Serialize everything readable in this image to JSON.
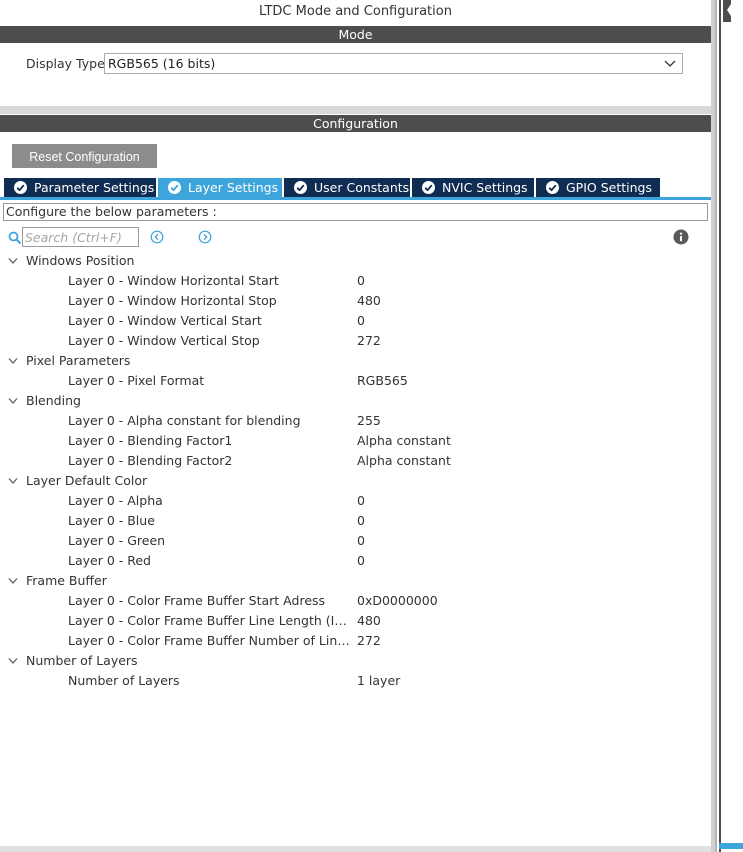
{
  "title": "LTDC Mode and Configuration",
  "mode": {
    "header": "Mode",
    "display_type_label": "Display Type",
    "display_type_value": "RGB565 (16 bits)"
  },
  "configuration": {
    "header": "Configuration",
    "reset_label": "Reset Configuration",
    "tabs": [
      {
        "label": "Parameter Settings",
        "active": false
      },
      {
        "label": "Layer Settings",
        "active": true
      },
      {
        "label": "User Constants",
        "active": false
      },
      {
        "label": "NVIC Settings",
        "active": false
      },
      {
        "label": "GPIO Settings",
        "active": false
      }
    ],
    "instructions": "Configure the below parameters :",
    "search_placeholder": "Search (Ctrl+F)"
  },
  "groups": [
    {
      "name": "Windows Position",
      "params": [
        {
          "name": "Layer 0 - Window Horizontal Start",
          "value": "0"
        },
        {
          "name": "Layer 0 - Window Horizontal Stop",
          "value": "480"
        },
        {
          "name": "Layer 0 - Window Vertical Start",
          "value": "0"
        },
        {
          "name": "Layer 0 - Window Vertical Stop",
          "value": "272"
        }
      ]
    },
    {
      "name": "Pixel Parameters",
      "params": [
        {
          "name": "Layer 0 - Pixel Format",
          "value": "RGB565"
        }
      ]
    },
    {
      "name": "Blending",
      "params": [
        {
          "name": "Layer 0 - Alpha constant for blending",
          "value": "255"
        },
        {
          "name": "Layer 0 - Blending Factor1",
          "value": "Alpha constant"
        },
        {
          "name": "Layer 0 - Blending Factor2",
          "value": "Alpha constant"
        }
      ]
    },
    {
      "name": "Layer Default Color",
      "params": [
        {
          "name": "Layer 0 - Alpha",
          "value": "0"
        },
        {
          "name": "Layer 0 - Blue",
          "value": "0"
        },
        {
          "name": "Layer 0 - Green",
          "value": "0"
        },
        {
          "name": "Layer 0 - Red",
          "value": "0"
        }
      ]
    },
    {
      "name": "Frame Buffer",
      "params": [
        {
          "name": "Layer 0 - Color Frame Buffer Start Adress",
          "value": "0xD0000000"
        },
        {
          "name": "Layer 0 - Color Frame Buffer Line Length (Imag...",
          "value": "480"
        },
        {
          "name": "Layer 0 - Color Frame Buffer Number of Lines (I...",
          "value": "272"
        }
      ]
    },
    {
      "name": "Number of Layers",
      "params": [
        {
          "name": "Number of Layers",
          "value": "1 layer"
        }
      ]
    }
  ],
  "colors": {
    "section_header": "#4d4d4d",
    "tab_inactive": "#0f2d52",
    "tab_active": "#3da5dc",
    "reset_button": "#8c8c8c",
    "icon_blue": "#3da5dc"
  },
  "icons": {
    "search": "search-icon",
    "prev": "chevron-left-circle-icon",
    "next": "chevron-right-circle-icon",
    "info": "info-icon",
    "tab_check": "check-circle-icon",
    "caret": "chevron-down-icon",
    "dropdown": "chevron-down-icon"
  }
}
